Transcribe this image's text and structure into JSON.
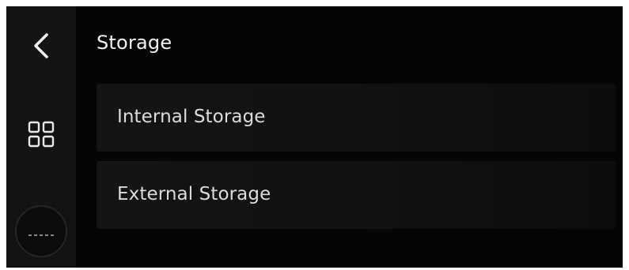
{
  "page": {
    "title": "Storage"
  },
  "sidebar": {
    "back_icon": "chevron-left-icon",
    "apps_icon": "grid-icon",
    "home_icon": "home-circle-icon"
  },
  "list": {
    "items": [
      {
        "label": "Internal Storage"
      },
      {
        "label": "External Storage"
      }
    ]
  },
  "colors": {
    "background": "#050505",
    "sidebar": "#131313",
    "list_item": "#141414",
    "title_text": "#f2f2f2",
    "item_text": "#dcdcdc"
  }
}
